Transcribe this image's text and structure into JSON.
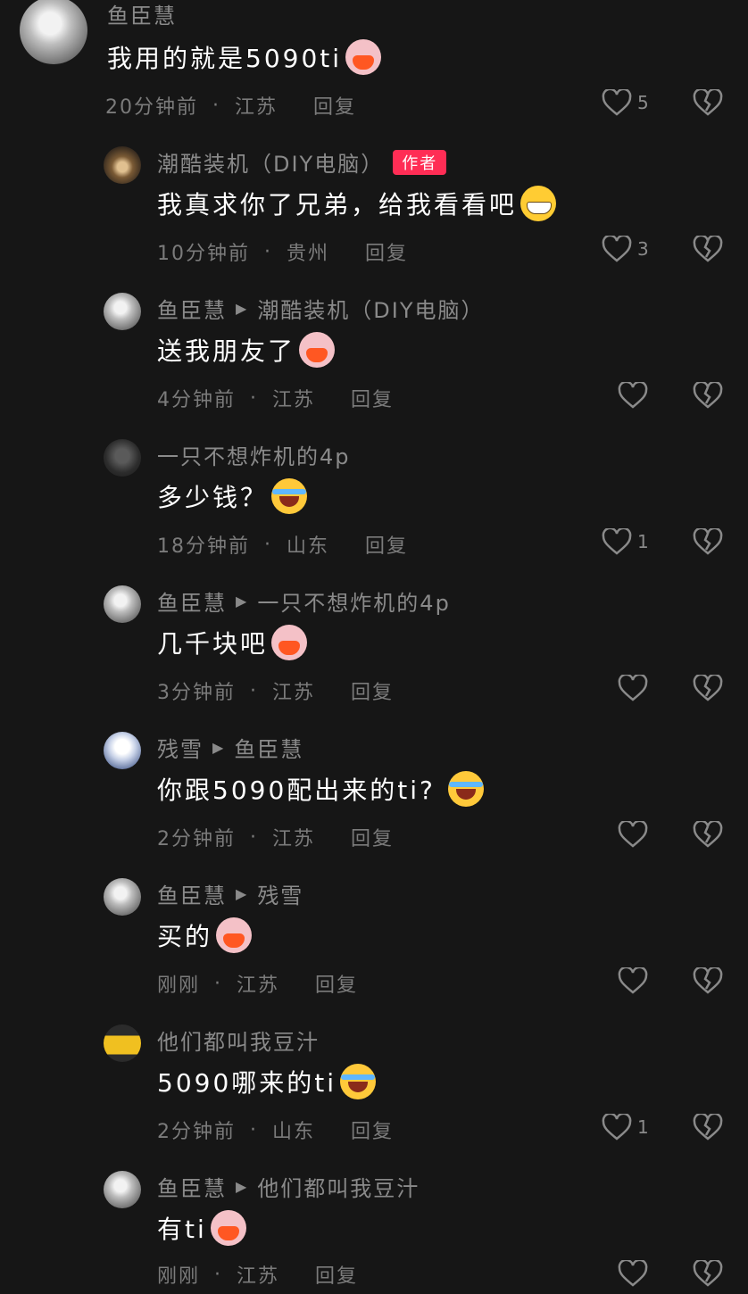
{
  "comments": [
    {
      "user": "鱼臣慧",
      "text": "我用的就是5090ti",
      "emoji": "pig-icon",
      "time": "20分钟前",
      "location": "江苏",
      "reply_label": "回复",
      "likes": "5"
    },
    {
      "user": "潮酷装机（DIY电脑）",
      "badge": "作者",
      "text": "我真求你了兄弟，给我看看吧",
      "emoji": "grin-icon",
      "time": "10分钟前",
      "location": "贵州",
      "reply_label": "回复",
      "likes": "3"
    },
    {
      "user": "鱼臣慧",
      "reply_to": "潮酷装机（DIY电脑）",
      "text": "送我朋友了",
      "emoji": "pig-icon",
      "time": "4分钟前",
      "location": "江苏",
      "reply_label": "回复",
      "likes": ""
    },
    {
      "user": "一只不想炸机的4p",
      "text": "多少钱？",
      "emoji": "laugh-icon",
      "time": "18分钟前",
      "location": "山东",
      "reply_label": "回复",
      "likes": "1"
    },
    {
      "user": "鱼臣慧",
      "reply_to": "一只不想炸机的4p",
      "text": "几千块吧",
      "emoji": "pig-icon",
      "time": "3分钟前",
      "location": "江苏",
      "reply_label": "回复",
      "likes": ""
    },
    {
      "user": "残雪",
      "reply_to": "鱼臣慧",
      "text": "你跟5090配出来的ti?",
      "emoji": "laugh-icon",
      "time": "2分钟前",
      "location": "江苏",
      "reply_label": "回复",
      "likes": ""
    },
    {
      "user": "鱼臣慧",
      "reply_to": "残雪",
      "text": "买的",
      "emoji": "pig-icon",
      "time": "刚刚",
      "location": "江苏",
      "reply_label": "回复",
      "likes": ""
    },
    {
      "user": "他们都叫我豆汁",
      "text": "5090哪来的ti",
      "emoji": "laugh-icon",
      "time": "2分钟前",
      "location": "山东",
      "reply_label": "回复",
      "likes": "1"
    },
    {
      "user": "鱼臣慧",
      "reply_to": "他们都叫我豆汁",
      "text": "有ti",
      "emoji": "pig-icon",
      "time": "刚刚",
      "location": "江苏",
      "reply_label": "回复",
      "likes": ""
    }
  ],
  "separator": "·",
  "colors": {
    "background": "#161616",
    "author_badge": "#ff2d55",
    "muted_text": "#8a8a8a"
  }
}
